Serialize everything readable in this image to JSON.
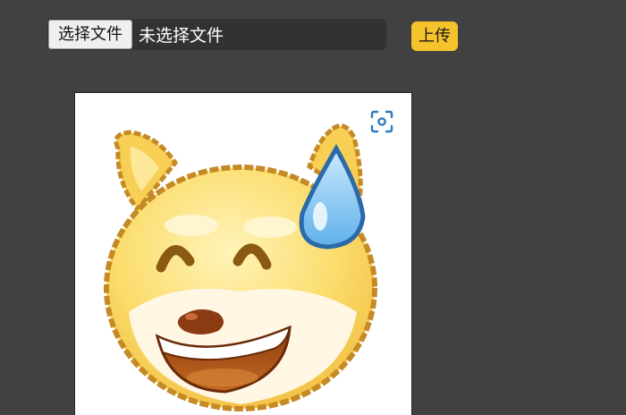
{
  "upload": {
    "choose_label": "选择文件",
    "status": "未选择文件",
    "submit_label": "上传"
  },
  "preview": {
    "image": "dog-emoji-grinning-sweat",
    "scan_icon": "image-scan-icon"
  },
  "colors": {
    "background": "#414141",
    "input_bg": "#323232",
    "accent": "#f5c32c",
    "scan_icon": "#2b7cc0"
  }
}
